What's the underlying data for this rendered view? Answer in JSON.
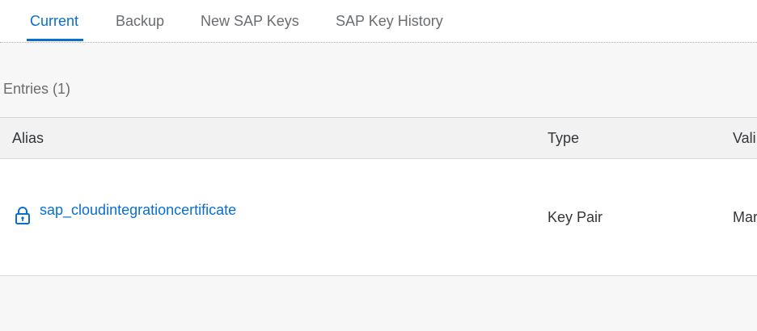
{
  "tabs": [
    {
      "label": "Current",
      "selected": true
    },
    {
      "label": "Backup",
      "selected": false
    },
    {
      "label": "New SAP Keys",
      "selected": false
    },
    {
      "label": "SAP Key History",
      "selected": false
    }
  ],
  "entries_label": "Entries (1)",
  "table": {
    "columns": [
      "Alias",
      "Type",
      "Vali"
    ],
    "rows": [
      {
        "icon": "lock-icon",
        "alias": "sap_cloudintegrationcertificate",
        "type": "Key Pair",
        "valid": "Mar"
      }
    ]
  },
  "colors": {
    "accent": "#0a6ed1",
    "text": "#32363a",
    "muted": "#6a6d70"
  }
}
